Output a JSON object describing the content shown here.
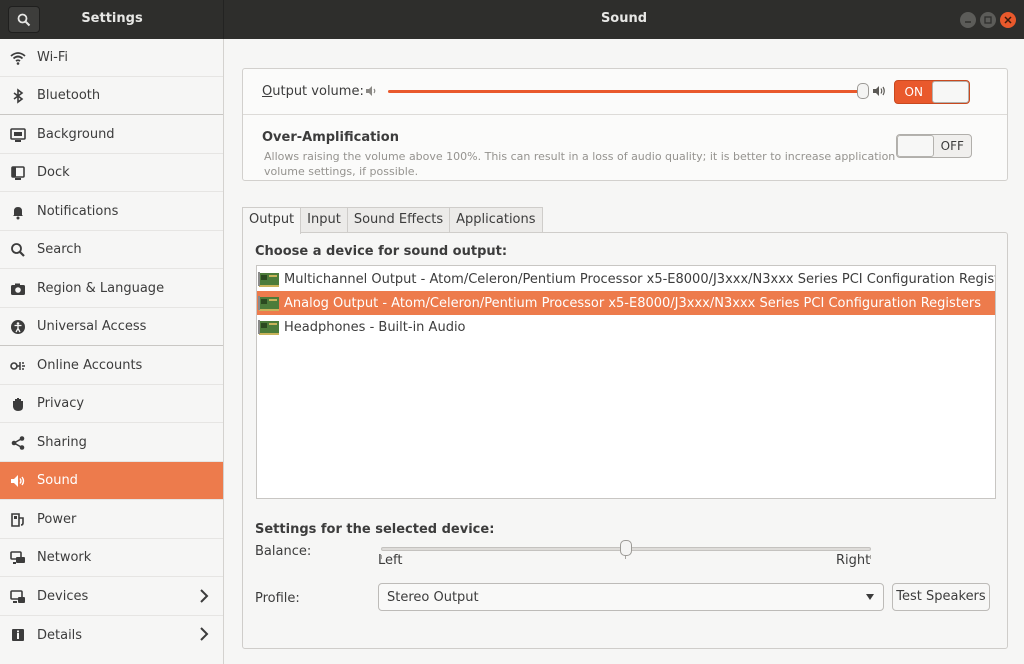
{
  "window": {
    "left_title": "Settings",
    "title": "Sound"
  },
  "sidebar": {
    "items": [
      {
        "label": "Wi-Fi",
        "icon": "wifi-icon"
      },
      {
        "label": "Bluetooth",
        "icon": "bluetooth-icon"
      },
      {
        "label": "Background",
        "icon": "background-icon"
      },
      {
        "label": "Dock",
        "icon": "dock-icon"
      },
      {
        "label": "Notifications",
        "icon": "bell-icon"
      },
      {
        "label": "Search",
        "icon": "search-icon"
      },
      {
        "label": "Region & Language",
        "icon": "camera-icon"
      },
      {
        "label": "Universal Access",
        "icon": "accessibility-icon"
      },
      {
        "label": "Online Accounts",
        "icon": "online-accounts-icon"
      },
      {
        "label": "Privacy",
        "icon": "hand-icon"
      },
      {
        "label": "Sharing",
        "icon": "share-icon"
      },
      {
        "label": "Sound",
        "icon": "speaker-icon",
        "active": true
      },
      {
        "label": "Power",
        "icon": "power-icon"
      },
      {
        "label": "Network",
        "icon": "network-icon"
      },
      {
        "label": "Devices",
        "icon": "devices-icon",
        "has_chevron": true
      },
      {
        "label": "Details",
        "icon": "details-icon",
        "has_chevron": true
      }
    ]
  },
  "output_volume": {
    "label_prefix": "O",
    "label_rest": "utput volume:",
    "level": 1.0,
    "switch_label": "ON",
    "accent_color": "#e9592c"
  },
  "over_amplification": {
    "title": "Over-Amplification",
    "description": "Allows raising the volume above 100%. This can result in a loss of audio quality; it is better to increase application volume settings, if possible.",
    "switch_label": "OFF"
  },
  "tabs": [
    {
      "label": "Output",
      "active": true
    },
    {
      "label": "Input"
    },
    {
      "label": "Sound Effects"
    },
    {
      "label": "Applications"
    }
  ],
  "output_panel": {
    "choose_label": "Choose a device for sound output:",
    "devices": [
      {
        "label": "Multichannel Output - Atom/Celeron/Pentium Processor x5-E8000/J3xxx/N3xxx Series PCI Configuration Registers"
      },
      {
        "label": "Analog Output - Atom/Celeron/Pentium Processor x5-E8000/J3xxx/N3xxx Series PCI Configuration Registers",
        "selected": true
      },
      {
        "label": "Headphones - Built-in Audio"
      }
    ],
    "settings_label": "Settings for the selected device:",
    "balance_label": "Balance:",
    "balance_left": "Left",
    "balance_right": "Right",
    "balance_value": 0.5,
    "profile_label": "Profile:",
    "profile_value": "Stereo Output",
    "test_button": "Test Speakers"
  }
}
